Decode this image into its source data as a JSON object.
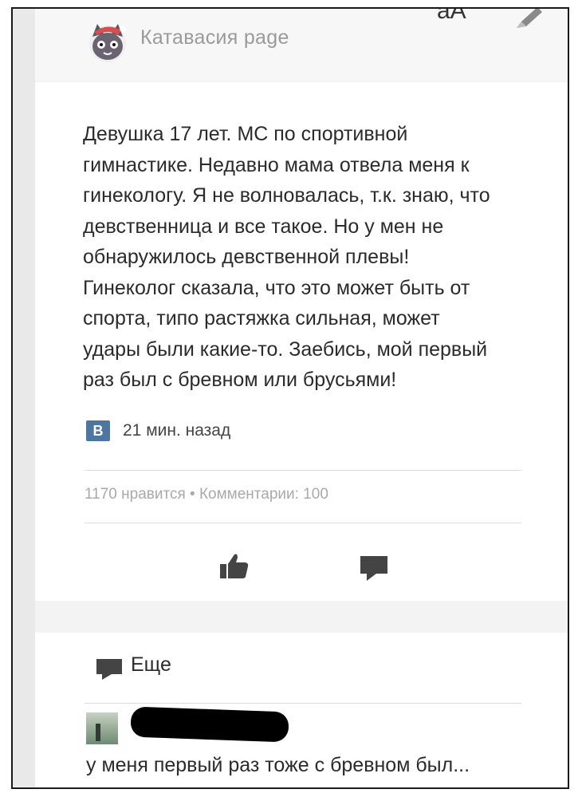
{
  "header": {
    "page_name": "Катавасия page",
    "font_size_label": "аА",
    "avatar_icon": "cat-avatar-icon",
    "edit_icon": "pencil-icon"
  },
  "post": {
    "text": "Девушка 17 лет. МС по спортивной\nгимнастике. Недавно мама отвела меня к\nгинекологу. Я не волновалась, т.к. знаю, что\nдевственница и все такое. Но у мен не\nобнаружилось девственной плевы!\nГинеколог сказала, что это может быть от\nспорта, типо растяжка сильная, может\nудары были какие-то. Заебись, мой первый\nраз был с бревном или брусьями!",
    "source_badge": "B",
    "timestamp": "21 мин. назад",
    "stats": "1170 нравится • Комментарии: 100",
    "actions": {
      "like_icon": "thumbs-up-icon",
      "comment_icon": "comment-icon"
    }
  },
  "comments": {
    "more_label": "Еще",
    "more_icon": "comment-icon",
    "first_comment_text": "у меня первый раз тоже с бревном был..."
  },
  "colors": {
    "vk_blue": "#4d76a1",
    "text": "#2b2b2b",
    "muted": "#a9a9a9",
    "background": "#f3f3f3"
  }
}
